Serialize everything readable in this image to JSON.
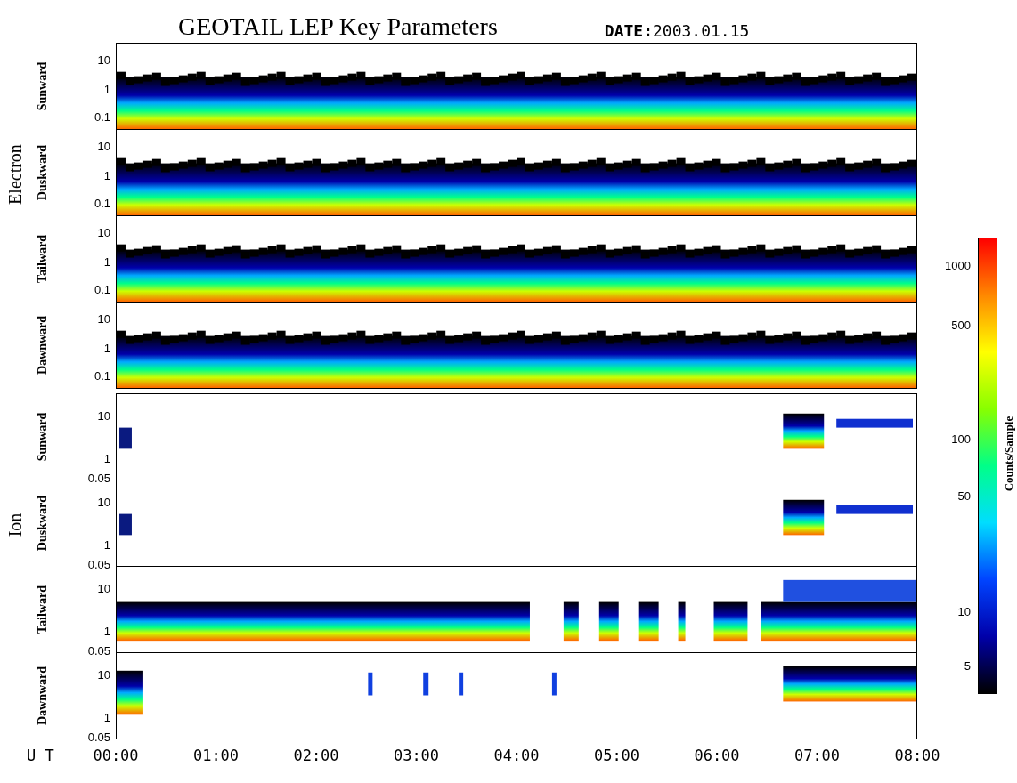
{
  "title": "GEOTAIL LEP Key Parameters",
  "date": "**DATE:**2003.01.15",
  "groups": [
    {
      "name": "Electron",
      "panels": [
        {
          "label": "Sunward",
          "kind": "electron",
          "yticks": [
            "10",
            "1",
            "0.1"
          ]
        },
        {
          "label": "Duskward",
          "kind": "electron",
          "yticks": [
            "10",
            "1",
            "0.1"
          ]
        },
        {
          "label": "Tailward",
          "kind": "electron",
          "yticks": [
            "10",
            "1",
            "0.1"
          ]
        },
        {
          "label": "Dawnward",
          "kind": "electron",
          "yticks": [
            "10",
            "1",
            "0.1"
          ]
        }
      ]
    },
    {
      "name": "Ion",
      "panels": [
        {
          "label": "Sunward",
          "kind": "ion-sparse",
          "yticks": [
            "10",
            "1",
            "0.05"
          ]
        },
        {
          "label": "Duskward",
          "kind": "ion-sparse",
          "yticks": [
            "10",
            "1",
            "0.05"
          ]
        },
        {
          "label": "Tailward",
          "kind": "ion-band",
          "yticks": [
            "10",
            "1",
            "0.05"
          ]
        },
        {
          "label": "Dawnward",
          "kind": "ion-patchy",
          "yticks": [
            "10",
            "1",
            "0.05"
          ]
        }
      ]
    }
  ],
  "xaxis": {
    "label": "U T",
    "ticks": [
      "00:00",
      "01:00",
      "02:00",
      "03:00",
      "04:00",
      "05:00",
      "06:00",
      "07:00",
      "08:00"
    ]
  },
  "colorbar": {
    "label": "Counts/Sample",
    "ticks": [
      "1000",
      "500",
      "100",
      "50",
      "10",
      "5"
    ]
  }
}
